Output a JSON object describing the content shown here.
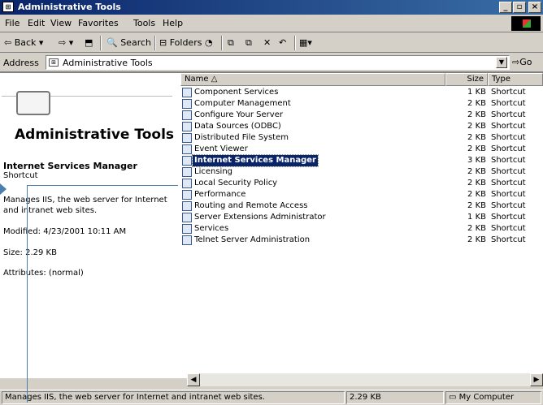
{
  "window": {
    "title": "Administrative Tools"
  },
  "menu": [
    "File",
    "Edit",
    "View",
    "Favorites",
    "Tools",
    "Help"
  ],
  "toolbar": {
    "back": "Back",
    "search": "Search",
    "folders": "Folders"
  },
  "address": {
    "label": "Address",
    "value": "Administrative Tools",
    "go": "Go"
  },
  "left": {
    "title": "Administrative Tools",
    "item_name": "Internet Services Manager",
    "item_type": "Shortcut",
    "description": "Manages IIS, the web server for Internet and intranet web sites.",
    "modified": "Modified: 4/23/2001 10:11 AM",
    "size": "Size: 2.29 KB",
    "attributes": "Attributes: (normal)"
  },
  "columns": {
    "name": "Name",
    "size": "Size",
    "type": "Type"
  },
  "files": [
    {
      "name": "Component Services",
      "size": "1 KB",
      "type": "Shortcut"
    },
    {
      "name": "Computer Management",
      "size": "2 KB",
      "type": "Shortcut"
    },
    {
      "name": "Configure Your Server",
      "size": "2 KB",
      "type": "Shortcut"
    },
    {
      "name": "Data Sources (ODBC)",
      "size": "2 KB",
      "type": "Shortcut"
    },
    {
      "name": "Distributed File System",
      "size": "2 KB",
      "type": "Shortcut"
    },
    {
      "name": "Event Viewer",
      "size": "2 KB",
      "type": "Shortcut"
    },
    {
      "name": "Internet Services Manager",
      "size": "3 KB",
      "type": "Shortcut",
      "selected": true
    },
    {
      "name": "Licensing",
      "size": "2 KB",
      "type": "Shortcut"
    },
    {
      "name": "Local Security Policy",
      "size": "2 KB",
      "type": "Shortcut"
    },
    {
      "name": "Performance",
      "size": "2 KB",
      "type": "Shortcut"
    },
    {
      "name": "Routing and Remote Access",
      "size": "2 KB",
      "type": "Shortcut"
    },
    {
      "name": "Server Extensions Administrator",
      "size": "1 KB",
      "type": "Shortcut"
    },
    {
      "name": "Services",
      "size": "2 KB",
      "type": "Shortcut"
    },
    {
      "name": "Telnet Server Administration",
      "size": "2 KB",
      "type": "Shortcut"
    }
  ],
  "status": {
    "text": "Manages IIS, the web server for Internet and intranet web sites.",
    "size": "2.29 KB",
    "zone": "My Computer"
  }
}
